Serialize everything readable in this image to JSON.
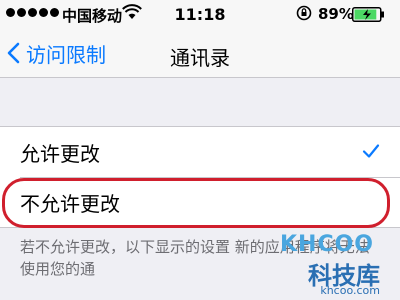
{
  "status_bar": {
    "carrier": "中国移动",
    "time": "11:18",
    "battery_percent": "89%",
    "battery_level": 0.89
  },
  "nav": {
    "back_label": "访问限制",
    "title": "通讯录"
  },
  "options": [
    {
      "label": "允许更改",
      "selected": true
    },
    {
      "label": "不允许更改",
      "selected": false
    }
  ],
  "footer_note": "若不允许更改，以下显示的设置 新的应用程序将无法使用您的通",
  "watermark": {
    "brand": "KHCOO",
    "name_cn": "科技库",
    "url": "khcoo.com"
  },
  "colors": {
    "accent": "#0a7aff",
    "highlight": "#d01f2d",
    "battery": "#4cd964"
  }
}
